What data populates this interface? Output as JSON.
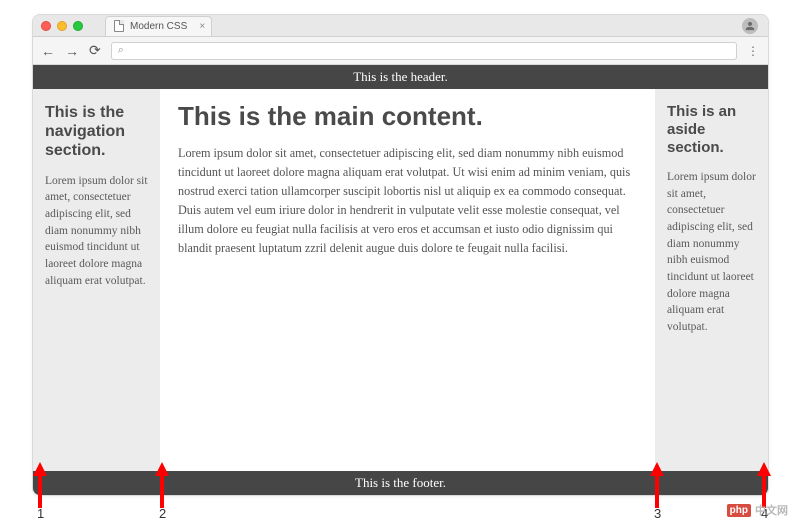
{
  "browser": {
    "tab_title": "Modern CSS",
    "url_placeholder": "⌕"
  },
  "page": {
    "header": "This is the header.",
    "footer": "This is the footer.",
    "nav": {
      "heading": "This is the navigation section.",
      "body": "Lorem ipsum dolor sit amet, consectetuer adipiscing elit, sed diam nonummy nibh euismod tincidunt ut laoreet dolore magna aliquam erat volutpat."
    },
    "main": {
      "heading": "This is the main content.",
      "body": "Lorem ipsum dolor sit amet, consectetuer adipiscing elit, sed diam nonummy nibh euismod tincidunt ut laoreet dolore magna aliquam erat volutpat. Ut wisi enim ad minim veniam, quis nostrud exerci tation ullamcorper suscipit lobortis nisl ut aliquip ex ea commodo consequat. Duis autem vel eum iriure dolor in hendrerit in vulputate velit esse molestie consequat, vel illum dolore eu feugiat nulla facilisis at vero eros et accumsan et iusto odio dignissim qui blandit praesent luptatum zzril delenit augue duis dolore te feugait nulla facilisi."
    },
    "aside": {
      "heading": "This is an aside section.",
      "body": "Lorem ipsum dolor sit amet, consectetuer adipiscing elit, sed diam nonummy nibh euismod tincidunt ut laoreet dolore magna aliquam erat volutpat."
    }
  },
  "annotations": {
    "labels": [
      "1",
      "2",
      "3",
      "4"
    ]
  },
  "watermark": {
    "badge": "php",
    "text": "中文网"
  }
}
